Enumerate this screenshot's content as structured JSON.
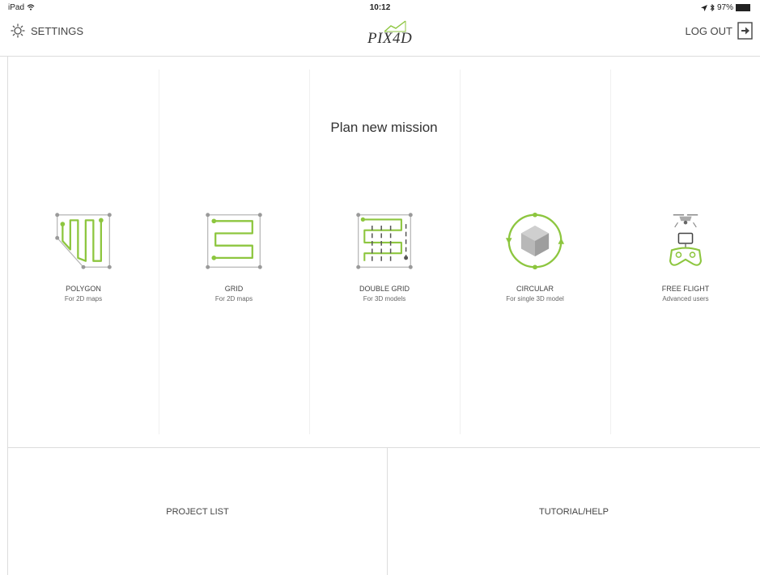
{
  "status_bar": {
    "device": "iPad",
    "time": "10:12",
    "battery": "97%",
    "battery_level": 0.97
  },
  "header": {
    "settings_label": "SETTINGS",
    "logo_text": "PIX4D",
    "logout_label": "LOG OUT"
  },
  "main": {
    "title": "Plan new mission",
    "options": [
      {
        "label": "POLYGON",
        "sublabel": "For 2D maps",
        "icon": "polygon-icon"
      },
      {
        "label": "GRID",
        "sublabel": "For 2D maps",
        "icon": "grid-icon"
      },
      {
        "label": "DOUBLE GRID",
        "sublabel": "For 3D models",
        "icon": "double-grid-icon"
      },
      {
        "label": "CIRCULAR",
        "sublabel": "For single 3D model",
        "icon": "circular-icon"
      },
      {
        "label": "FREE FLIGHT",
        "sublabel": "Advanced users",
        "icon": "drone-icon"
      }
    ]
  },
  "bottom": {
    "project_list": "PROJECT LIST",
    "tutorial_help": "TUTORIAL/HELP"
  },
  "colors": {
    "accent": "#8dc63f",
    "icon_gray": "#9a9a9a",
    "divider": "#dcdcdc"
  }
}
